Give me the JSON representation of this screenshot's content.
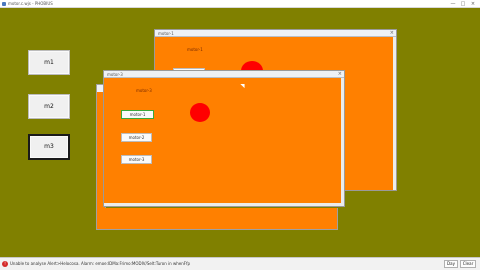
{
  "app": {
    "title": "motor.c.wjs - PHOBIUS",
    "controls": {
      "minimize": "—",
      "maximize": "□",
      "close": "×"
    }
  },
  "main": {
    "buttons": [
      {
        "label": "m1",
        "selected": false
      },
      {
        "label": "m2",
        "selected": false
      },
      {
        "label": "m3",
        "selected": true
      }
    ]
  },
  "windows": {
    "back": {
      "title": "motor-1",
      "label": "motor-1",
      "dot_color": "#ff0000"
    },
    "front": {
      "title": "motor-3",
      "label": "motor-3",
      "dot_color": "#ff0000",
      "buttons": [
        "motor-1",
        "motor-2",
        "motor-3"
      ],
      "selected_button": "motor-1"
    },
    "close_glyph": "×"
  },
  "statusbar": {
    "message": "Unable to analyse Alert>Helocosa. Alarm: emoe:IDMa:Frimo:MODIV/Selt:Turon in whenFfp",
    "copy_label": "Day",
    "clear_label": "Clear"
  },
  "colors": {
    "canvas": "#808000",
    "window": "#ff8000",
    "dot": "#ff0000",
    "selected_border": "#3aa83a"
  },
  "icons": {
    "app_icon": "app-icon",
    "error_icon": "error-icon"
  }
}
